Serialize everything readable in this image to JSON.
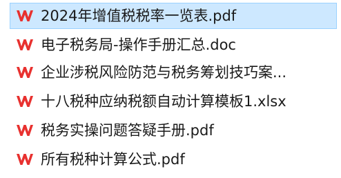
{
  "files": [
    {
      "name": "2024年增值税税率一览表.pdf",
      "icon": "wps-pdf-icon",
      "selected": true
    },
    {
      "name": "电子税务局-操作手册汇总.doc",
      "icon": "wps-writer-icon",
      "selected": false
    },
    {
      "name": "企业涉税风险防范与税务筹划技巧案...",
      "icon": "wps-writer-icon",
      "selected": false
    },
    {
      "name": "十八税种应纳税额自动计算模板1.xlsx",
      "icon": "wps-sheet-icon",
      "selected": false
    },
    {
      "name": "税务实操问题答疑手册.pdf",
      "icon": "wps-pdf-icon",
      "selected": false
    },
    {
      "name": "所有税种计算公式.pdf",
      "icon": "wps-pdf-icon",
      "selected": false
    }
  ],
  "colors": {
    "wps_red": "#e8312f",
    "selection_bg": "#cde8ff",
    "selection_border": "#99d1ff"
  }
}
